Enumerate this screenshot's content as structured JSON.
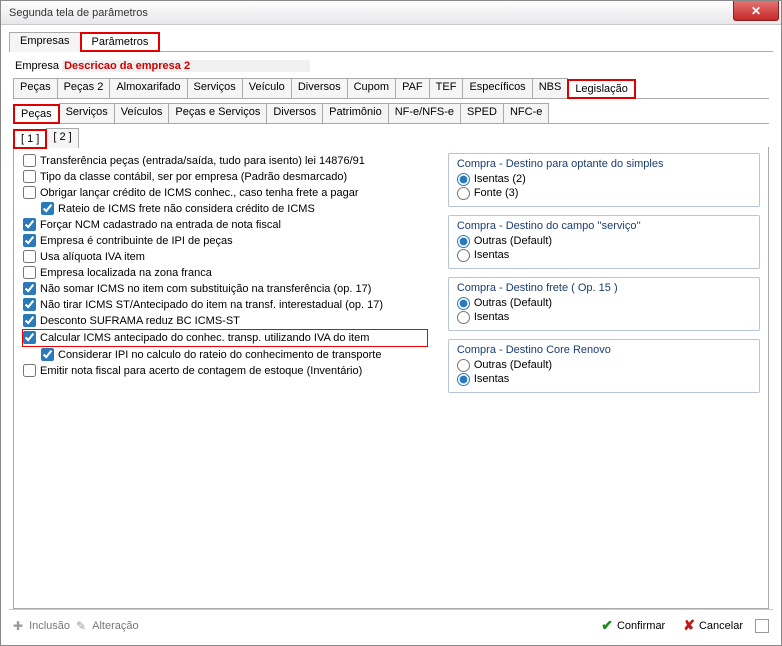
{
  "window": {
    "title": "Segunda tela de parâmetros"
  },
  "outerTabs": {
    "empresas": "Empresas",
    "parametros": "Parâmetros"
  },
  "empresa": {
    "label": "Empresa",
    "name": "Descricao da empresa 2"
  },
  "tabs1": {
    "pecas": "Peças",
    "pecas2": "Peças 2",
    "almox": "Almoxarifado",
    "serv": "Serviços",
    "veic": "Veículo",
    "div": "Diversos",
    "cupom": "Cupom",
    "paf": "PAF",
    "tef": "TEF",
    "esp": "Específicos",
    "nbs": "NBS",
    "legis": "Legislação"
  },
  "tabs2": {
    "pecas": "Peças",
    "serv": "Serviços",
    "veic": "Veículos",
    "pserv": "Peças e Serviços",
    "div": "Diversos",
    "patr": "Patrimônio",
    "nfe": "NF-e/NFS-e",
    "sped": "SPED",
    "nfce": "NFC-e"
  },
  "tabs3": {
    "t1": "[ 1 ]",
    "t2": "[ 2 ]"
  },
  "chk": {
    "c1": "Transferência peças (entrada/saída, tudo para isento) lei 14876/91",
    "c2": "Tipo da classe contábil, ser por empresa (Padrão desmarcado)",
    "c3": "Obrigar lançar crédito de ICMS conhec., caso tenha frete a pagar",
    "c3a": "Rateio de ICMS frete não considera crédito de ICMS",
    "c4": "Forçar NCM cadastrado na entrada de nota fiscal",
    "c5": "Empresa é contribuinte de IPI de peças",
    "c6": "Usa alíquota IVA item",
    "c7": "Empresa localizada na zona franca",
    "c8": "Não somar ICMS no item com substituição na transferência (op. 17)",
    "c9": "Não tirar ICMS ST/Antecipado do item na transf. interestadual (op. 17)",
    "c10": "Desconto SUFRAMA reduz BC ICMS-ST",
    "c11": "Calcular ICMS antecipado do conhec. transp. utilizando IVA do item",
    "c11a": "Considerar IPI no calculo do rateio do conhecimento de transporte",
    "c12": "Emitir nota fiscal para acerto de contagem de estoque (Inventário)"
  },
  "groups": {
    "g1": {
      "title": "Compra - Destino para optante do simples",
      "r1": "Isentas (2)",
      "r2": "Fonte (3)"
    },
    "g2": {
      "title": "Compra - Destino do campo ''serviço''",
      "r1": "Outras (Default)",
      "r2": "Isentas"
    },
    "g3": {
      "title": "Compra - Destino frete ( Op. 15 )",
      "r1": "Outras (Default)",
      "r2": "Isentas"
    },
    "g4": {
      "title": "Compra - Destino Core Renovo",
      "r1": "Outras (Default)",
      "r2": "Isentas"
    }
  },
  "footer": {
    "inclusao": "Inclusão",
    "alteracao": "Alteração",
    "confirmar": "Confirmar",
    "cancelar": "Cancelar"
  }
}
